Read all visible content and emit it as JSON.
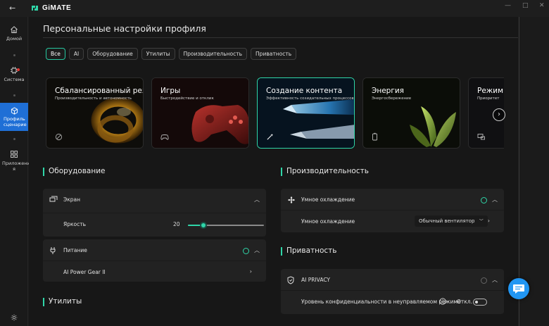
{
  "app": {
    "name": "GiMATE"
  },
  "window": {
    "back": "←",
    "minimize": "—",
    "maximize": "□",
    "close": "✕"
  },
  "sidebar": {
    "items": [
      {
        "label": "Домой",
        "icon": "home-icon"
      },
      {
        "label": "Система",
        "icon": "cpu-icon",
        "badge": "red-dot"
      },
      {
        "label": "Профиль сценарие",
        "icon": "cube-icon",
        "active": true
      },
      {
        "label": "Приложени я",
        "icon": "apps-grid-icon"
      }
    ],
    "settings_icon": "gear-icon"
  },
  "page": {
    "title": "Персональные настройки профиля"
  },
  "filters": [
    "Все",
    "AI",
    "Оборудование",
    "Утилиты",
    "Производительность",
    "Приватность"
  ],
  "scenarios": [
    {
      "title": "Сбалансированный режим",
      "subtitle": "Производительность и автономность",
      "icon": "balance-icon"
    },
    {
      "title": "Игры",
      "subtitle": "Быстродействие и отклик",
      "icon": "gamepad-icon"
    },
    {
      "title": "Создание контента",
      "subtitle": "Эффективность созидательных процессов",
      "icon": "magic-wand-icon",
      "selected": true
    },
    {
      "title": "Энергия",
      "subtitle": "Энергосбережение",
      "icon": "battery-leaf-icon"
    },
    {
      "title": "Режим о",
      "subtitle": "Приоритет",
      "icon": "monitor-icon"
    }
  ],
  "next_label": "›",
  "hardware": {
    "title": "Оборудование",
    "screen": {
      "label": "Экран",
      "brightness_label": "Яркость",
      "brightness_value": "20",
      "brightness_fraction": 0.2
    },
    "power": {
      "label": "Питание",
      "sub_label": "AI Power Gear II"
    }
  },
  "utilities": {
    "title": "Утилиты"
  },
  "performance": {
    "title": "Производительность",
    "cooling": {
      "label": "Умное охлаждение",
      "sub_label": "Умное охлаждение",
      "mode": "Обычный вентилятор"
    }
  },
  "privacy": {
    "title": "Приватность",
    "ai_privacy": {
      "label": "AI PRIVACY",
      "sub_label": "Уровень конфиденциальности в неуправляемом режиме",
      "toggle_state": "Откл."
    }
  },
  "colors": {
    "accent": "#2fd6a8",
    "active_nav": "#1f6fd6",
    "chat": "#2196f3"
  }
}
